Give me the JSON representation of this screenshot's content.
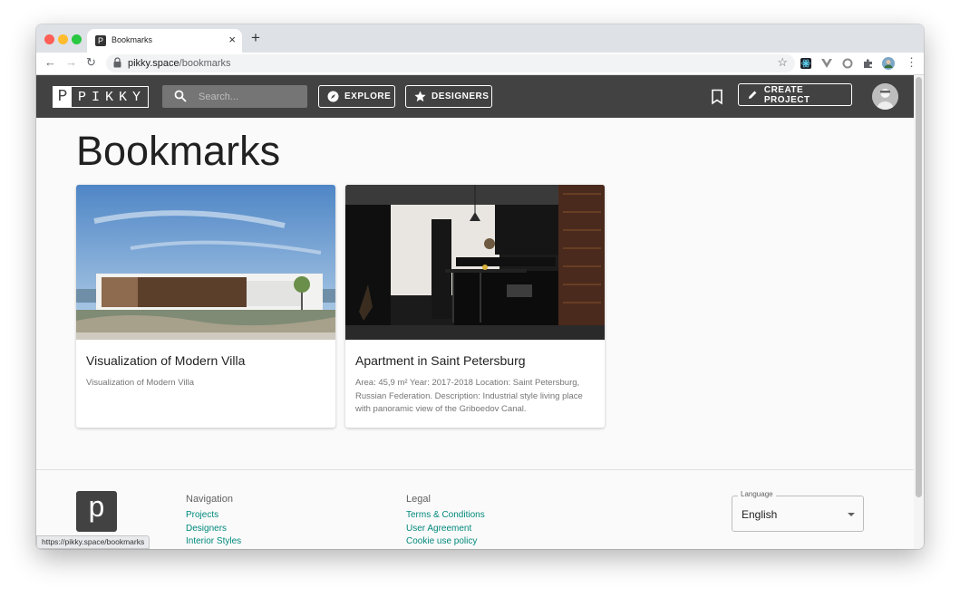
{
  "browser": {
    "tab_favicon": "P",
    "tab_title": "Bookmarks",
    "tab_close": "×",
    "new_tab": "+",
    "url_host": "pikky.space",
    "url_path": "/bookmarks",
    "status_url": "https://pikky.space/bookmarks",
    "back_icon": "←",
    "forward_icon": "→",
    "reload_icon": "↻",
    "star_icon": "☆",
    "menu_icon": "⋮"
  },
  "header": {
    "logo_letter": "P",
    "logo_word": "PIKKY",
    "search_placeholder": "Search...",
    "explore_label": "EXPLORE",
    "designers_label": "DESIGNERS",
    "create_label": "CREATE PROJECT"
  },
  "page": {
    "title": "Bookmarks"
  },
  "cards": [
    {
      "title": "Visualization of Modern Villa",
      "description": "Visualization of Modern Villa"
    },
    {
      "title": "Apartment in Saint Petersburg",
      "description": "Area: 45,9 m² Year: 2017-2018 Location: Saint Petersburg, Russian Federation. Description: Industrial style living place with panoramic view of the Griboedov Canal."
    }
  ],
  "footer": {
    "logo_letter": "p",
    "navigation": {
      "heading": "Navigation",
      "links": [
        "Projects",
        "Designers",
        "Interior Styles"
      ]
    },
    "legal": {
      "heading": "Legal",
      "links": [
        "Terms & Conditions",
        "User Agreement",
        "Cookie use policy"
      ]
    },
    "language": {
      "label": "Language",
      "value": "English"
    }
  },
  "colors": {
    "appbar": "#424242",
    "link": "#00897b",
    "page_bg": "#fafafa"
  }
}
